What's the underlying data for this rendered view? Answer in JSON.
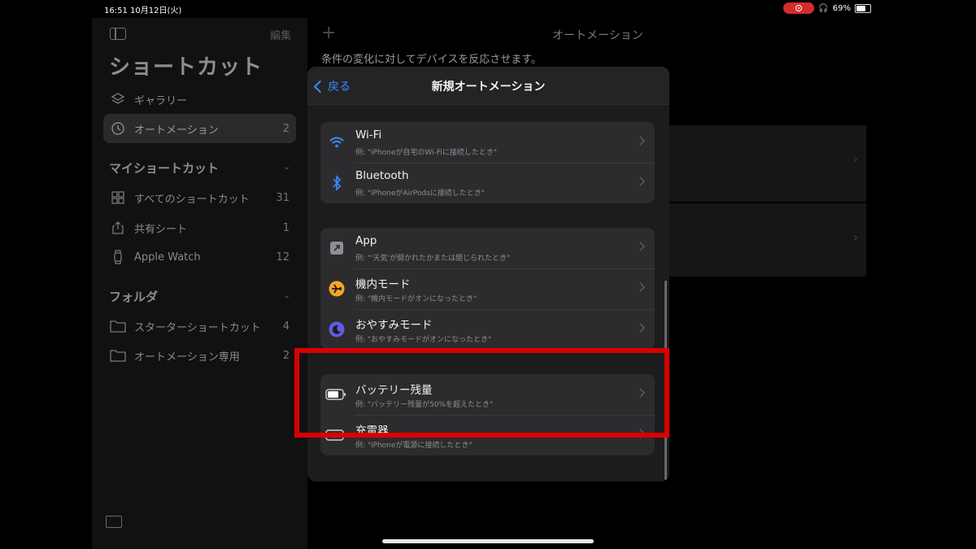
{
  "status": {
    "time": "16:51",
    "date": "10月12日(火)",
    "battery": "69%",
    "battery_level": 0.69
  },
  "sidebar": {
    "edit": "編集",
    "title": "ショートカット",
    "items": [
      {
        "label": "ギャラリー",
        "icon": "layers-icon"
      },
      {
        "label": "オートメーション",
        "count": "2",
        "icon": "clock-icon"
      }
    ],
    "my_section": "マイショートカット",
    "my_items": [
      {
        "label": "すべてのショートカット",
        "count": "31",
        "icon": "grid-icon"
      },
      {
        "label": "共有シート",
        "count": "1",
        "icon": "share-icon"
      },
      {
        "label": "Apple Watch",
        "count": "12",
        "icon": "watch-icon"
      }
    ],
    "folder_section": "フォルダ",
    "folders": [
      {
        "label": "スターターショートカット",
        "count": "4"
      },
      {
        "label": "オートメーション専用",
        "count": "2"
      }
    ]
  },
  "main": {
    "title": "オートメーション",
    "subtitle": "条件の変化に対してデバイスを反応させます。"
  },
  "modal": {
    "back": "戻る",
    "title": "新規オートメーション",
    "groups": [
      [
        {
          "title": "Wi-Fi",
          "subtitle": "例: \"iPhoneが自宅のWi-Fiに接続したとき\"",
          "icon": "wifi-icon"
        },
        {
          "title": "Bluetooth",
          "subtitle": "例: \"iPhoneがAirPodsに接続したとき\"",
          "icon": "bluetooth-icon"
        }
      ],
      [
        {
          "title": "App",
          "subtitle": "例: \"'天気'が開かれたかまたは閉じられたとき\"",
          "icon": "app-arrow-icon"
        },
        {
          "title": "機内モード",
          "subtitle": "例: \"機内モードがオンになったとき\"",
          "icon": "airplane-icon"
        },
        {
          "title": "おやすみモード",
          "subtitle": "例: \"おやすみモードがオンになったとき\"",
          "icon": "moon-icon"
        }
      ],
      [
        {
          "title": "バッテリー残量",
          "subtitle": "例: \"バッテリー残量が50%を超えたとき\"",
          "icon": "battery-icon"
        },
        {
          "title": "充電器",
          "subtitle": "例: \"iPhoneが電源に接続したとき\"",
          "icon": "charger-icon"
        }
      ]
    ]
  },
  "colors": {
    "accent": "#3a8cff",
    "highlight": "#d90000",
    "airplane": "#f5a623",
    "moon": "#5e5ce6"
  }
}
